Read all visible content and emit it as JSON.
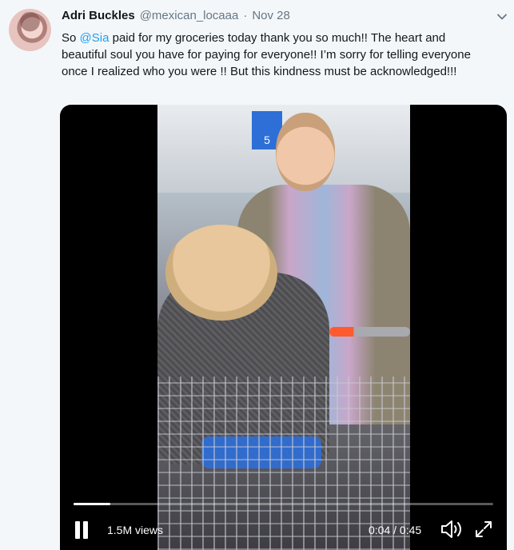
{
  "tweet": {
    "author_name": "Adri Buckles",
    "handle": "@mexican_locaaa",
    "separator": "·",
    "date": "Nov 28",
    "text_before_mention": "So ",
    "mention": "@Sia",
    "text_after_mention": " paid for my groceries today thank you so much!! The heart and beautiful soul you have for paying for everyone!! I’m sorry for telling everyone once I realized who you were !! But this kindness must be acknowledged!!!"
  },
  "video": {
    "store_sign": "5",
    "views": "1.5M views",
    "time": "0:04 / 0:45",
    "progress": 0.088
  },
  "icons": {
    "avatar": "avatar",
    "more": "chevron-down-icon",
    "pause": "pause-icon",
    "volume": "volume-icon",
    "fullscreen": "fullscreen-icon"
  },
  "colors": {
    "link": "#1da1f2",
    "text": "#14171a",
    "muted": "#657786",
    "background": "#f4f7f9"
  }
}
